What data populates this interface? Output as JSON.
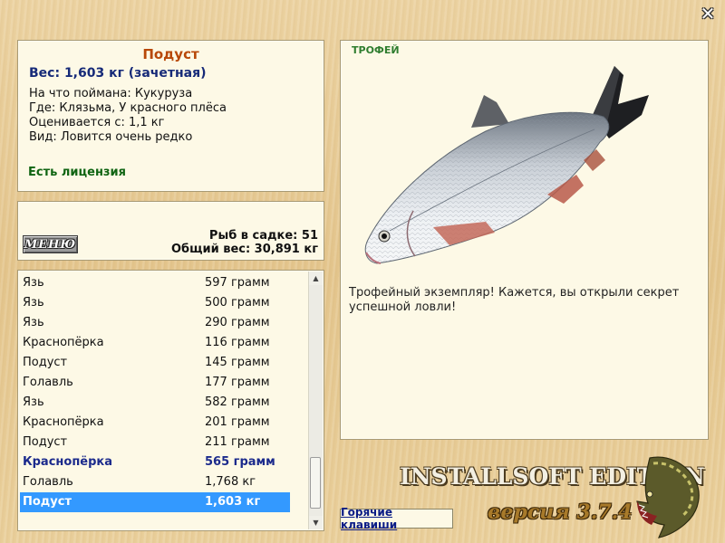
{
  "fish": {
    "name": "Подуст",
    "weight_line": "Вес: 1,603 кг (зачетная)",
    "caught_on": "На что поймана: Кукуруза",
    "where": "Где: Клязьма, У красного плёса",
    "valued_from": "Оценивается с: 1,1 кг",
    "kind": "Вид: Ловится очень редко",
    "license": "Есть лицензия"
  },
  "catch": {
    "menu_label": "МЕНЮ",
    "fish_count": "Рыб в садке: 51",
    "total_weight": "Общий вес: 30,891 кг"
  },
  "list": {
    "rows": [
      {
        "name": "Язь",
        "weight": "597 грамм"
      },
      {
        "name": "Язь",
        "weight": "500 грамм"
      },
      {
        "name": "Язь",
        "weight": "290 грамм"
      },
      {
        "name": "Краснопёрка",
        "weight": "116 грамм"
      },
      {
        "name": "Подуст",
        "weight": "145 грамм"
      },
      {
        "name": "Голавль",
        "weight": "177 грамм"
      },
      {
        "name": "Язь",
        "weight": "582 грамм"
      },
      {
        "name": "Краснопёрка",
        "weight": "201 грамм"
      },
      {
        "name": "Подуст",
        "weight": "211 грамм"
      },
      {
        "name": "Краснопёрка",
        "weight": "565 грамм"
      },
      {
        "name": "Голавль",
        "weight": "1,768 кг"
      },
      {
        "name": "Подуст",
        "weight": "1,603 кг"
      }
    ]
  },
  "trophy": {
    "label": "ТРОФЕЙ",
    "text": "Трофейный экземпляр! Кажется, вы открыли секрет успешной ловли!"
  },
  "branding": {
    "edition": "INSTALLSOFT EDITION",
    "version": "версия 3.7.4",
    "hotkeys": "Горячие клавиши"
  },
  "icons": {
    "close": "close-icon",
    "scroll_up": "scroll-up-arrow-icon",
    "scroll_down": "scroll-down-arrow-icon",
    "fish": "fish-image",
    "pike": "pike-logo-icon"
  },
  "colors": {
    "selection": "#3399ff",
    "highlight_row": "#1b2a8c",
    "fish_name": "#b84808",
    "license": "#0f6412",
    "trophy_label": "#2f7d2f"
  }
}
